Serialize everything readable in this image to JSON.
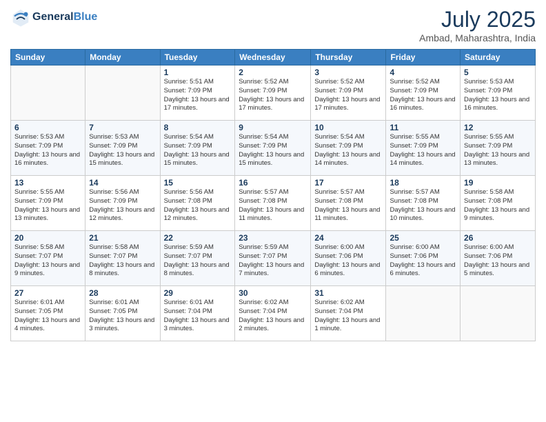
{
  "header": {
    "logo_line1": "General",
    "logo_line2": "Blue",
    "month": "July 2025",
    "location": "Ambad, Maharashtra, India"
  },
  "weekdays": [
    "Sunday",
    "Monday",
    "Tuesday",
    "Wednesday",
    "Thursday",
    "Friday",
    "Saturday"
  ],
  "weeks": [
    [
      {
        "day": "",
        "info": ""
      },
      {
        "day": "",
        "info": ""
      },
      {
        "day": "1",
        "info": "Sunrise: 5:51 AM\nSunset: 7:09 PM\nDaylight: 13 hours\nand 17 minutes."
      },
      {
        "day": "2",
        "info": "Sunrise: 5:52 AM\nSunset: 7:09 PM\nDaylight: 13 hours\nand 17 minutes."
      },
      {
        "day": "3",
        "info": "Sunrise: 5:52 AM\nSunset: 7:09 PM\nDaylight: 13 hours\nand 17 minutes."
      },
      {
        "day": "4",
        "info": "Sunrise: 5:52 AM\nSunset: 7:09 PM\nDaylight: 13 hours\nand 16 minutes."
      },
      {
        "day": "5",
        "info": "Sunrise: 5:53 AM\nSunset: 7:09 PM\nDaylight: 13 hours\nand 16 minutes."
      }
    ],
    [
      {
        "day": "6",
        "info": "Sunrise: 5:53 AM\nSunset: 7:09 PM\nDaylight: 13 hours\nand 16 minutes."
      },
      {
        "day": "7",
        "info": "Sunrise: 5:53 AM\nSunset: 7:09 PM\nDaylight: 13 hours\nand 15 minutes."
      },
      {
        "day": "8",
        "info": "Sunrise: 5:54 AM\nSunset: 7:09 PM\nDaylight: 13 hours\nand 15 minutes."
      },
      {
        "day": "9",
        "info": "Sunrise: 5:54 AM\nSunset: 7:09 PM\nDaylight: 13 hours\nand 15 minutes."
      },
      {
        "day": "10",
        "info": "Sunrise: 5:54 AM\nSunset: 7:09 PM\nDaylight: 13 hours\nand 14 minutes."
      },
      {
        "day": "11",
        "info": "Sunrise: 5:55 AM\nSunset: 7:09 PM\nDaylight: 13 hours\nand 14 minutes."
      },
      {
        "day": "12",
        "info": "Sunrise: 5:55 AM\nSunset: 7:09 PM\nDaylight: 13 hours\nand 13 minutes."
      }
    ],
    [
      {
        "day": "13",
        "info": "Sunrise: 5:55 AM\nSunset: 7:09 PM\nDaylight: 13 hours\nand 13 minutes."
      },
      {
        "day": "14",
        "info": "Sunrise: 5:56 AM\nSunset: 7:09 PM\nDaylight: 13 hours\nand 12 minutes."
      },
      {
        "day": "15",
        "info": "Sunrise: 5:56 AM\nSunset: 7:08 PM\nDaylight: 13 hours\nand 12 minutes."
      },
      {
        "day": "16",
        "info": "Sunrise: 5:57 AM\nSunset: 7:08 PM\nDaylight: 13 hours\nand 11 minutes."
      },
      {
        "day": "17",
        "info": "Sunrise: 5:57 AM\nSunset: 7:08 PM\nDaylight: 13 hours\nand 11 minutes."
      },
      {
        "day": "18",
        "info": "Sunrise: 5:57 AM\nSunset: 7:08 PM\nDaylight: 13 hours\nand 10 minutes."
      },
      {
        "day": "19",
        "info": "Sunrise: 5:58 AM\nSunset: 7:08 PM\nDaylight: 13 hours\nand 9 minutes."
      }
    ],
    [
      {
        "day": "20",
        "info": "Sunrise: 5:58 AM\nSunset: 7:07 PM\nDaylight: 13 hours\nand 9 minutes."
      },
      {
        "day": "21",
        "info": "Sunrise: 5:58 AM\nSunset: 7:07 PM\nDaylight: 13 hours\nand 8 minutes."
      },
      {
        "day": "22",
        "info": "Sunrise: 5:59 AM\nSunset: 7:07 PM\nDaylight: 13 hours\nand 8 minutes."
      },
      {
        "day": "23",
        "info": "Sunrise: 5:59 AM\nSunset: 7:07 PM\nDaylight: 13 hours\nand 7 minutes."
      },
      {
        "day": "24",
        "info": "Sunrise: 6:00 AM\nSunset: 7:06 PM\nDaylight: 13 hours\nand 6 minutes."
      },
      {
        "day": "25",
        "info": "Sunrise: 6:00 AM\nSunset: 7:06 PM\nDaylight: 13 hours\nand 6 minutes."
      },
      {
        "day": "26",
        "info": "Sunrise: 6:00 AM\nSunset: 7:06 PM\nDaylight: 13 hours\nand 5 minutes."
      }
    ],
    [
      {
        "day": "27",
        "info": "Sunrise: 6:01 AM\nSunset: 7:05 PM\nDaylight: 13 hours\nand 4 minutes."
      },
      {
        "day": "28",
        "info": "Sunrise: 6:01 AM\nSunset: 7:05 PM\nDaylight: 13 hours\nand 3 minutes."
      },
      {
        "day": "29",
        "info": "Sunrise: 6:01 AM\nSunset: 7:04 PM\nDaylight: 13 hours\nand 3 minutes."
      },
      {
        "day": "30",
        "info": "Sunrise: 6:02 AM\nSunset: 7:04 PM\nDaylight: 13 hours\nand 2 minutes."
      },
      {
        "day": "31",
        "info": "Sunrise: 6:02 AM\nSunset: 7:04 PM\nDaylight: 13 hours\nand 1 minute."
      },
      {
        "day": "",
        "info": ""
      },
      {
        "day": "",
        "info": ""
      }
    ]
  ]
}
